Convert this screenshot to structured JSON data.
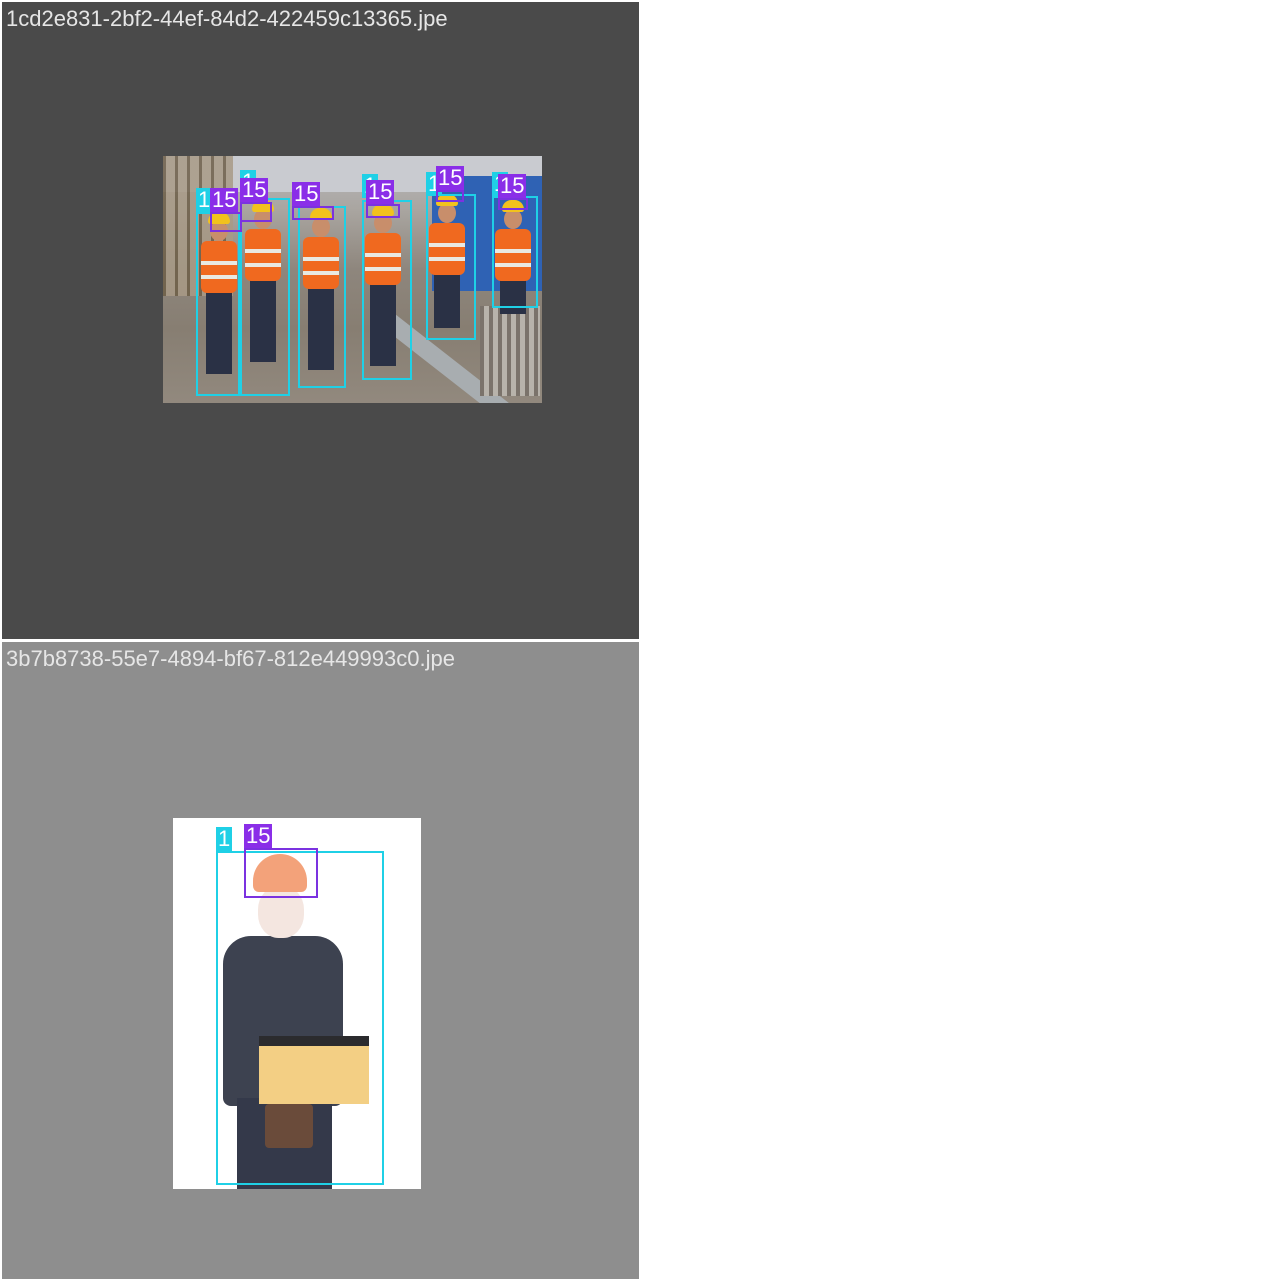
{
  "images": [
    {
      "filename": "1cd2e831-2bf2-44ef-84d2-422459c13365.jpe",
      "background_color": "#4a4a4a",
      "description": "construction workers in orange safety vests and yellow helmets",
      "annotations": {
        "person_label": "1",
        "helmet_label": "15",
        "person_count": 6,
        "helmet_count": 6
      }
    },
    {
      "filename": "3b7b8738-55e7-4894-bf67-812e449993c0.jpe",
      "background_color": "#8e8e8e",
      "description": "worker with orange helmet holding toolbox",
      "annotations": {
        "person_label": "1",
        "helmet_label": "15",
        "person_count": 1,
        "helmet_count": 1
      }
    }
  ],
  "colors": {
    "person_box": "#1fd0e6",
    "helmet_box": "#8a2ee8"
  }
}
